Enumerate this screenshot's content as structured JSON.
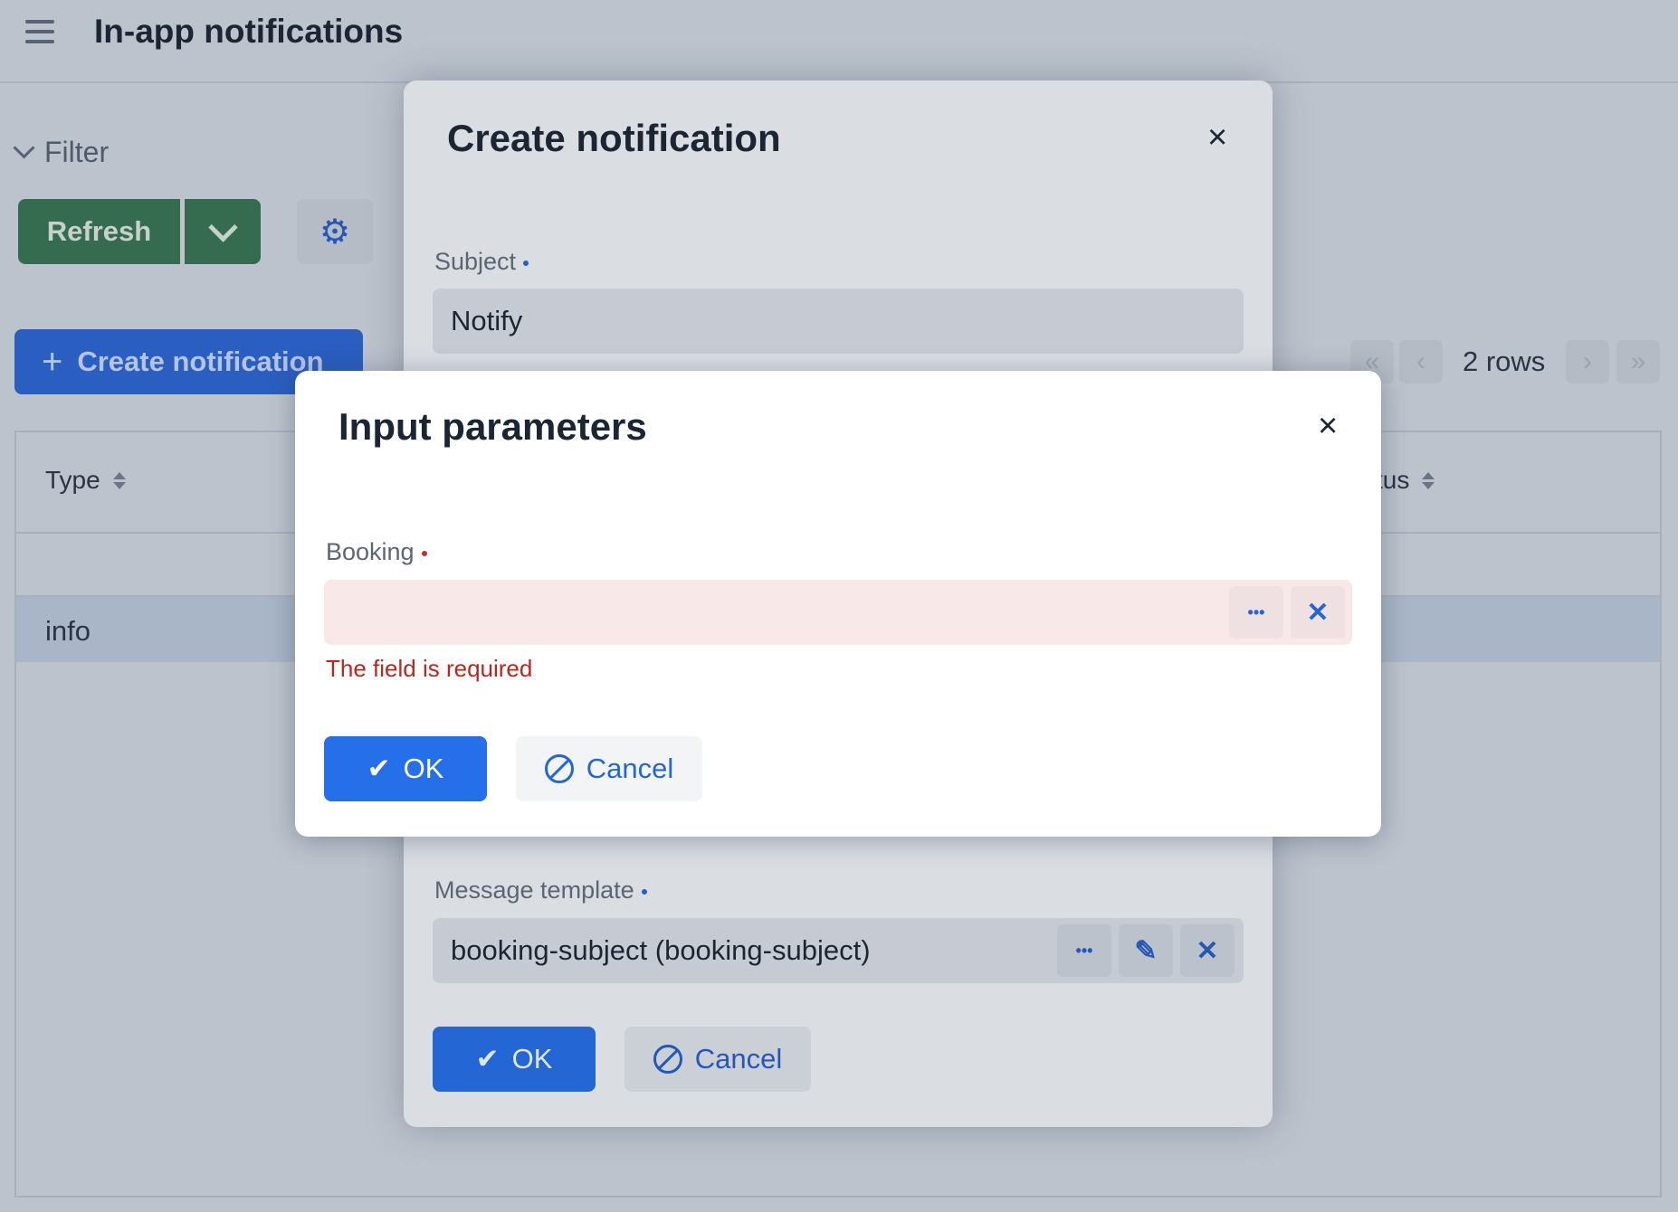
{
  "header": {
    "title": "In-app notifications",
    "menu_icon": "hamburger-icon"
  },
  "filter": {
    "label": "Filter"
  },
  "toolbar": {
    "refresh_label": "Refresh",
    "create_label": "Create notification",
    "create_icon": "+",
    "settings_icon": "⚙"
  },
  "pager": {
    "first": "«",
    "prev": "‹",
    "rows_label": "2 rows",
    "next": "›",
    "last": "»"
  },
  "table": {
    "columns": [
      {
        "label": "Type"
      },
      {
        "label": "Status"
      }
    ],
    "status_partial": "tus",
    "rows": [
      {
        "type": ""
      },
      {
        "type": "info"
      }
    ]
  },
  "create_dialog": {
    "title": "Create notification",
    "close": "×",
    "subject_label": "Subject",
    "subject_value": "Notify",
    "message_template_label": "Message template",
    "message_template_value": "booking-subject (booking-subject)",
    "lookup": "•••",
    "edit": "✎",
    "clear": "✕",
    "ok_label": "OK",
    "ok_icon": "✔",
    "cancel_label": "Cancel"
  },
  "input_dialog": {
    "title": "Input parameters",
    "close": "×",
    "booking_label": "Booking",
    "booking_value": "",
    "error": "The field is required",
    "lookup": "•••",
    "clear": "✕",
    "ok_label": "OK",
    "ok_icon": "✔",
    "cancel_label": "Cancel"
  },
  "colors": {
    "accent": "#2570e8",
    "success": "#356c4f",
    "error": "#b8281f",
    "error_bg": "#f9e8e8"
  }
}
